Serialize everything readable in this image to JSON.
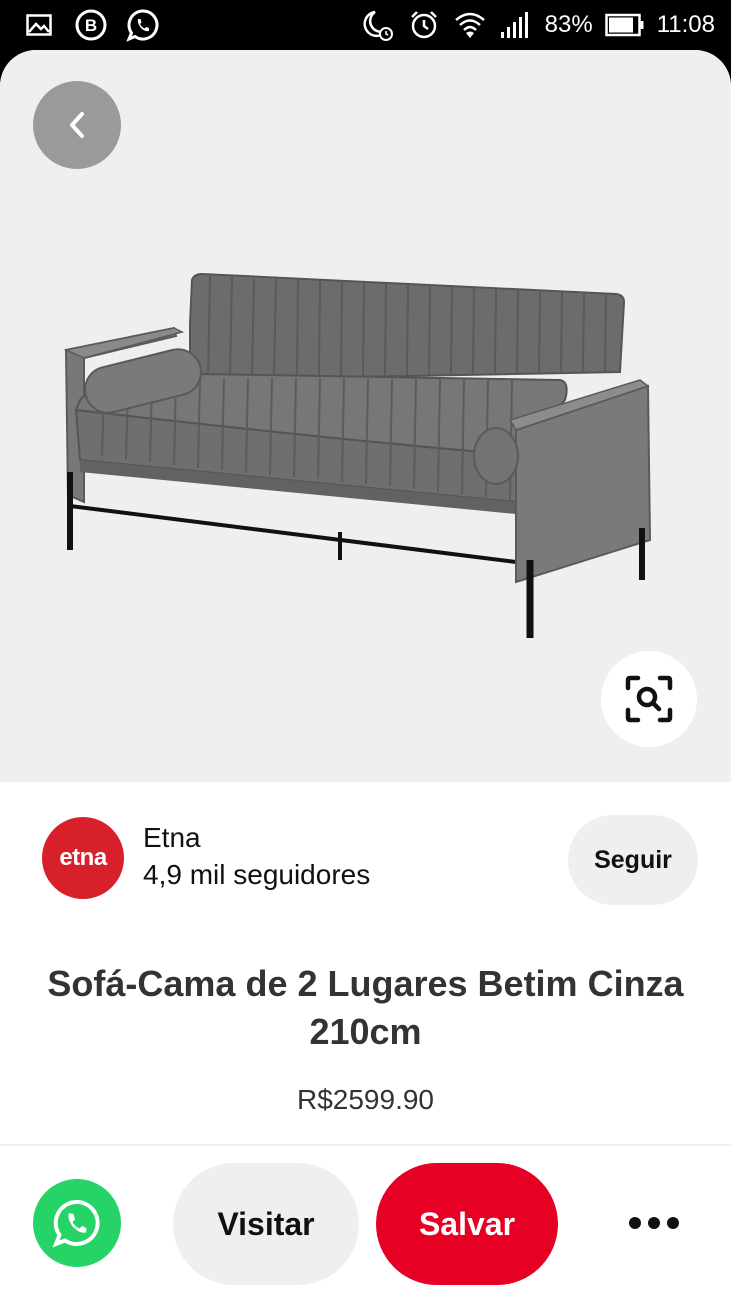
{
  "status_bar": {
    "battery_percent": "83%",
    "time": "11:08",
    "left_icons": [
      "image-notification-icon",
      "b-app-icon",
      "whatsapp-notification-icon"
    ],
    "right_icons": [
      "night-mode-alarm-icon",
      "alarm-clock-icon",
      "wifi-icon",
      "signal-icon",
      "battery-icon"
    ]
  },
  "pin": {
    "image_icons": [
      "back-icon",
      "visual-search-icon"
    ],
    "creator": {
      "avatar_text": "etna",
      "name": "Etna",
      "followers": "4,9 mil seguidores",
      "follow_label": "Seguir"
    },
    "title": "Sofá-Cama de 2 Lugares Betim Cinza 210cm",
    "price": "R$2599.90"
  },
  "action_bar": {
    "visit_label": "Visitar",
    "save_label": "Salvar",
    "icons": [
      "whatsapp-icon",
      "more-icon"
    ]
  },
  "colors": {
    "save": "#e60023",
    "whatsapp": "#25d366",
    "brand_avatar": "#d8202a",
    "image_bg": "#efefef"
  }
}
